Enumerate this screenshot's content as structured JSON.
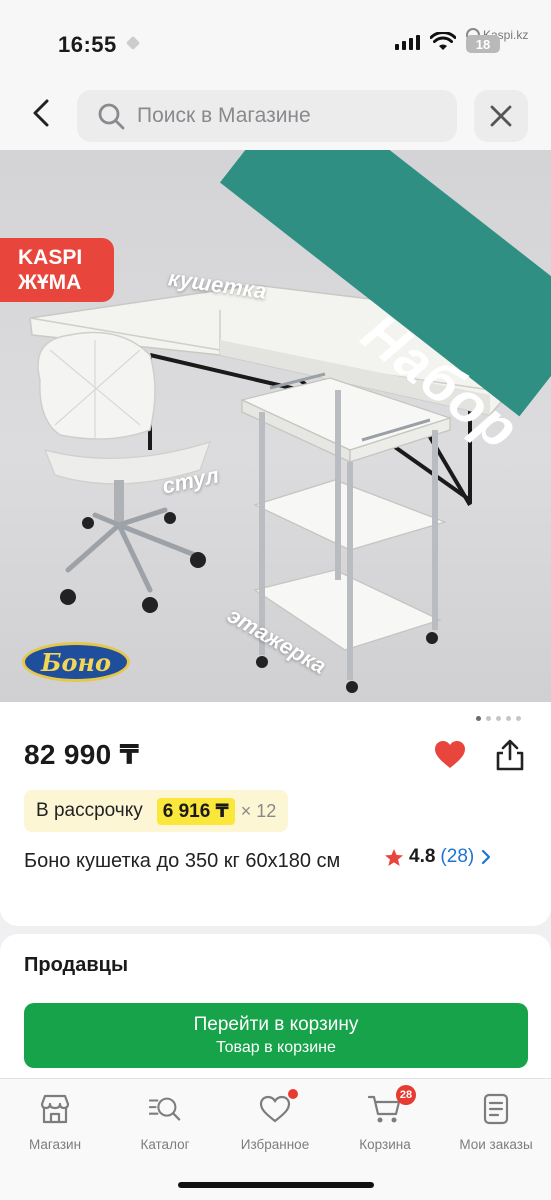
{
  "status_bar": {
    "time": "16:55",
    "site": "Kaspi.kz",
    "badge": "18"
  },
  "header": {
    "search_placeholder": "Поиск в Магазине"
  },
  "hero": {
    "promo_line1": "KASPI",
    "promo_line2": "ЖҰМА",
    "ribbon": "Набор",
    "label_couch": "кушетка",
    "label_chair": "стул",
    "label_shelf": "этажерка",
    "brand": "Боно",
    "pager": {
      "count": 5,
      "active": 1
    }
  },
  "product": {
    "price": "82 990 ₸",
    "installment_label": "В рассрочку",
    "installment_amount": "6 916 ₸",
    "installment_times": "× 12",
    "title": "Боно кушетка до 350 кг 60x180 см",
    "rating": "4.8",
    "reviews": "(28)",
    "colors": {
      "heart": "#e8453c",
      "star": "#e8453c",
      "reviews_link": "#1e74d2"
    }
  },
  "sellers": {
    "title": "Продавцы",
    "cta_line1": "Перейти в корзину",
    "cta_line2": "Товар в корзине",
    "cta_color": "#16a34a"
  },
  "tabbar": {
    "items": [
      {
        "label": "Магазин",
        "icon": "shop-icon"
      },
      {
        "label": "Каталог",
        "icon": "catalog-search-icon"
      },
      {
        "label": "Избранное",
        "icon": "heart-icon"
      },
      {
        "label": "Корзина",
        "icon": "cart-icon",
        "badge": "28"
      },
      {
        "label": "Мои заказы",
        "icon": "orders-icon"
      }
    ]
  }
}
